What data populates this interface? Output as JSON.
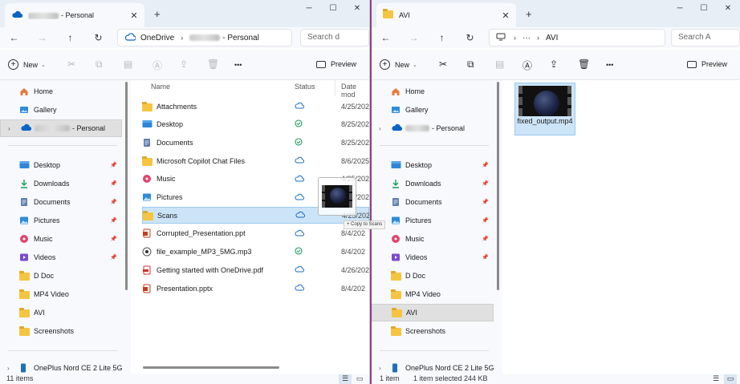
{
  "left": {
    "tab": {
      "title_suffix": "- Personal",
      "close": "✕"
    },
    "new_tab": "+",
    "window_controls": [
      "─",
      "☐",
      "✕"
    ],
    "nav": {
      "back": "←",
      "forward": "→",
      "up": "↑",
      "refresh": "↻"
    },
    "address": {
      "segments": [
        "OneDrive",
        "- Personal"
      ],
      "separator": "›"
    },
    "search_placeholder": "Search d",
    "toolbar": {
      "new_label": "New",
      "preview_label": "Preview",
      "more": "•••"
    },
    "sidebar": {
      "top": [
        {
          "label": "Home",
          "icon": "home-icon"
        },
        {
          "label": "Gallery",
          "icon": "gallery-icon"
        },
        {
          "label": "- Personal",
          "icon": "onedrive-icon"
        }
      ],
      "quick": [
        {
          "label": "Desktop",
          "icon": "desktop-folder-icon",
          "pinned": true
        },
        {
          "label": "Downloads",
          "icon": "downloads-icon",
          "pinned": true
        },
        {
          "label": "Documents",
          "icon": "documents-icon",
          "pinned": true
        },
        {
          "label": "Pictures",
          "icon": "pictures-icon",
          "pinned": true
        },
        {
          "label": "Music",
          "icon": "music-icon",
          "pinned": true
        },
        {
          "label": "Videos",
          "icon": "videos-icon",
          "pinned": true
        },
        {
          "label": "D Doc",
          "icon": "folder-icon",
          "pinned": false
        },
        {
          "label": "MP4 Video",
          "icon": "folder-icon",
          "pinned": false
        },
        {
          "label": "AVI",
          "icon": "folder-icon",
          "pinned": false
        },
        {
          "label": "Screenshots",
          "icon": "folder-icon",
          "pinned": false
        }
      ],
      "device": "OnePlus Nord CE 2 Lite 5G"
    },
    "columns": {
      "name": "Name",
      "status": "Status",
      "date": "Date mod"
    },
    "files": [
      {
        "name": "Attachments",
        "icon": "folder-icon",
        "status": "cloud",
        "date": "4/25/202"
      },
      {
        "name": "Desktop",
        "icon": "desktop-folder-icon",
        "status": "synced",
        "date": "8/25/202"
      },
      {
        "name": "Documents",
        "icon": "documents-icon",
        "status": "synced",
        "date": "8/25/202"
      },
      {
        "name": "Microsoft Copilot Chat Files",
        "icon": "folder-icon",
        "status": "cloud",
        "date": "8/6/2025"
      },
      {
        "name": "Music",
        "icon": "music-icon",
        "status": "cloud",
        "date": "4/25/202"
      },
      {
        "name": "Pictures",
        "icon": "pictures-icon",
        "status": "cloud",
        "date": "4/25/202"
      },
      {
        "name": "Scans",
        "icon": "folder-icon",
        "status": "cloud",
        "date": "4/25/202"
      },
      {
        "name": "Corrupted_Presentation.ppt",
        "icon": "ppt-file-icon",
        "status": "cloud",
        "date": "8/4/202"
      },
      {
        "name": "file_example_MP3_5MG.mp3",
        "icon": "mp3-file-icon",
        "status": "synced",
        "date": "8/4/202"
      },
      {
        "name": "Getting started with OneDrive.pdf",
        "icon": "pdf-file-icon",
        "status": "cloud",
        "date": "4/26/202"
      },
      {
        "name": "Presentation.pptx",
        "icon": "ppt-file-icon",
        "status": "cloud",
        "date": "8/4/202"
      }
    ],
    "status": {
      "count": "11 items"
    },
    "drag_tip": "+ Copy to Scans"
  },
  "right": {
    "tab": {
      "title": "AVI",
      "close": "✕"
    },
    "new_tab": "+",
    "window_controls": [
      "─",
      "☐",
      "✕"
    ],
    "nav": {
      "back": "←",
      "forward": "→",
      "up": "↑",
      "refresh": "↻"
    },
    "address": {
      "dots": "···",
      "segment": "AVI",
      "separator": "›"
    },
    "search_placeholder": "Search A",
    "toolbar": {
      "new_label": "New",
      "preview_label": "Preview",
      "more": "•••"
    },
    "sidebar": {
      "top": [
        {
          "label": "Home",
          "icon": "home-icon"
        },
        {
          "label": "Gallery",
          "icon": "gallery-icon"
        },
        {
          "label": "- Personal",
          "icon": "onedrive-icon"
        }
      ],
      "quick": [
        {
          "label": "Desktop",
          "icon": "desktop-folder-icon",
          "pinned": true
        },
        {
          "label": "Downloads",
          "icon": "downloads-icon",
          "pinned": true
        },
        {
          "label": "Documents",
          "icon": "documents-icon",
          "pinned": true
        },
        {
          "label": "Pictures",
          "icon": "pictures-icon",
          "pinned": true
        },
        {
          "label": "Music",
          "icon": "music-icon",
          "pinned": true
        },
        {
          "label": "Videos",
          "icon": "videos-icon",
          "pinned": true
        },
        {
          "label": "D Doc",
          "icon": "folder-icon",
          "pinned": false
        },
        {
          "label": "MP4 Video",
          "icon": "folder-icon",
          "pinned": false
        },
        {
          "label": "AVI",
          "icon": "folder-icon",
          "pinned": false
        },
        {
          "label": "Screenshots",
          "icon": "folder-icon",
          "pinned": false
        }
      ],
      "device": "OnePlus Nord CE 2 Lite 5G"
    },
    "file": {
      "name": "fixed_output.mp4",
      "icon": "video-file-icon"
    },
    "status": {
      "count": "1 item",
      "selected": "1 item selected  244 KB"
    }
  },
  "colors": {
    "accent": "#0067c0",
    "selection": "#cce4f7",
    "folder": "#f5c542",
    "window_border": "#8e3f8e"
  }
}
